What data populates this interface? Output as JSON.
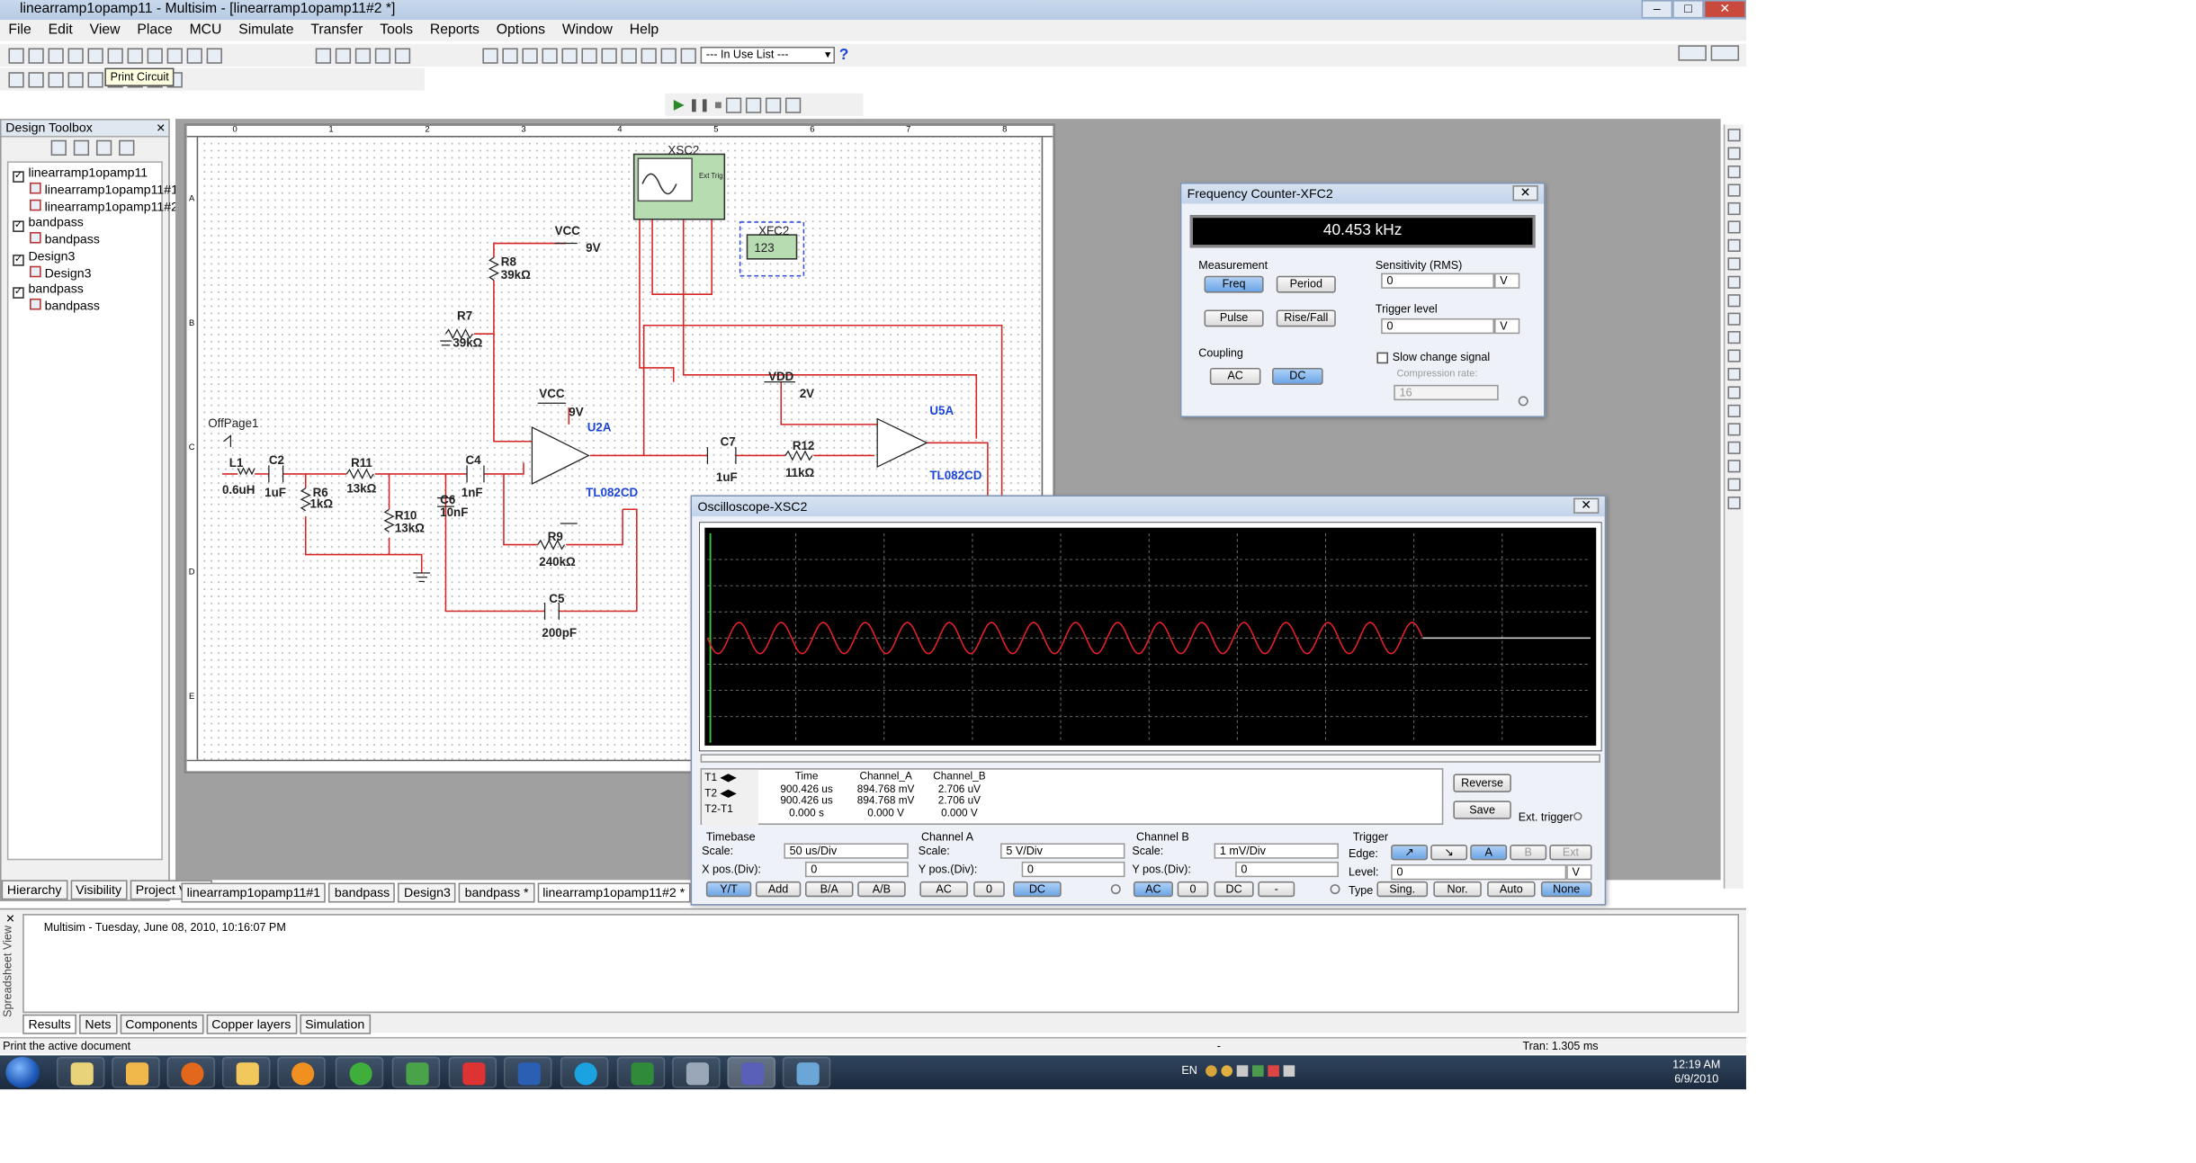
{
  "window": {
    "title": "linearramp1opamp11 - Multisim - [linearramp1opamp11#2 *]",
    "buttons": [
      "–",
      "□",
      "✕"
    ]
  },
  "menu": [
    "File",
    "Edit",
    "View",
    "Place",
    "MCU",
    "Simulate",
    "Transfer",
    "Tools",
    "Reports",
    "Options",
    "Window",
    "Help"
  ],
  "toolbar": {
    "tooltip": "Print Circuit",
    "in_use_list": "--- In Use List ---",
    "help": "?"
  },
  "toolbox": {
    "title": "Design Toolbox",
    "tree": [
      {
        "label": "linearramp1opamp11",
        "level": 0,
        "checked": true
      },
      {
        "label": "linearramp1opamp11#1",
        "level": 1
      },
      {
        "label": "linearramp1opamp11#2",
        "level": 1
      },
      {
        "label": "bandpass",
        "level": 0,
        "checked": true
      },
      {
        "label": "bandpass",
        "level": 1
      },
      {
        "label": "Design3",
        "level": 0,
        "checked": true
      },
      {
        "label": "Design3",
        "level": 1
      },
      {
        "label": "bandpass",
        "level": 0,
        "checked": true
      },
      {
        "label": "bandpass",
        "level": 1
      }
    ],
    "tabs": [
      "Hierarchy",
      "Visibility",
      "Project View"
    ]
  },
  "doc_tabs": [
    "linearramp1opamp11#1",
    "bandpass",
    "Design3",
    "bandpass *",
    "linearramp1opamp11#2 *"
  ],
  "schematic": {
    "ruler_top": [
      "0",
      "1",
      "2",
      "3",
      "4",
      "5",
      "6",
      "7",
      "8"
    ],
    "ruler_left": [
      "A",
      "B",
      "C",
      "D",
      "E"
    ],
    "labels": {
      "xsc2": "XSC2",
      "xfc2": "XFC2",
      "xfc2_val": "123",
      "ext_trig": "Ext Trig",
      "vcc1": "VCC",
      "v9a": "9V",
      "r8": "R8",
      "r8v": "39kΩ",
      "r7": "R7",
      "r7v": "39kΩ",
      "vcc2": "VCC",
      "v9b": "9V",
      "u2a": "U2A",
      "tl1": "TL082CD",
      "offpage": "OffPage1",
      "l1": "L1",
      "l1v": "0.6uH",
      "c2": "C2",
      "c2v": "1uF",
      "r11": "R11",
      "r11v": "13kΩ",
      "c4": "C4",
      "c4v": "1nF",
      "r6": "R6",
      "r6v": "1kΩ",
      "c6": "C6",
      "c6v": "10nF",
      "r10": "R10",
      "r10v": "13kΩ",
      "r9": "R9",
      "r9v": "240kΩ",
      "c5": "C5",
      "c5v": "200pF",
      "vdd": "VDD",
      "v2": "2V",
      "c7": "C7",
      "c7v": "1uF",
      "r12": "R12",
      "r12v": "11kΩ",
      "u5a": "U5A",
      "tl2": "TL082CD"
    }
  },
  "freq_counter": {
    "title": "Frequency Counter-XFC2",
    "display": "40.453 kHz",
    "measurement": "Measurement",
    "freq": "Freq",
    "period": "Period",
    "pulse": "Pulse",
    "risefall": "Rise/Fall",
    "coupling": "Coupling",
    "ac": "AC",
    "dc": "DC",
    "sensitivity": "Sensitivity (RMS)",
    "sens_val": "0",
    "sens_unit": "V",
    "trigger": "Trigger level",
    "trig_val": "0",
    "trig_unit": "V",
    "slow": "Slow change signal",
    "comp": "Compression rate:",
    "comp_val": "16"
  },
  "oscilloscope": {
    "title": "Oscilloscope-XSC2",
    "readout": {
      "headers": [
        "Time",
        "Channel_A",
        "Channel_B"
      ],
      "rows": [
        {
          "label": "T1",
          "time": "900.426 us",
          "a": "894.768 mV",
          "b": "2.706 uV"
        },
        {
          "label": "T2",
          "time": "900.426 us",
          "a": "894.768 mV",
          "b": "2.706 uV"
        },
        {
          "label": "T2-T1",
          "time": "0.000 s",
          "a": "0.000 V",
          "b": "0.000 V"
        }
      ]
    },
    "reverse": "Reverse",
    "save": "Save",
    "ext_trigger": "Ext. trigger",
    "timebase": {
      "title": "Timebase",
      "scale_lbl": "Scale:",
      "scale": "50 us/Div",
      "xpos_lbl": "X pos.(Div):",
      "xpos": "0",
      "buttons": [
        "Y/T",
        "Add",
        "B/A",
        "A/B"
      ]
    },
    "chA": {
      "title": "Channel A",
      "scale_lbl": "Scale:",
      "scale": "5  V/Div",
      "ypos_lbl": "Y pos.(Div):",
      "ypos": "0",
      "buttons": [
        "AC",
        "0",
        "DC"
      ]
    },
    "chB": {
      "title": "Channel B",
      "scale_lbl": "Scale:",
      "scale": "1 mV/Div",
      "ypos_lbl": "Y pos.(Div):",
      "ypos": "0",
      "buttons": [
        "AC",
        "0",
        "DC",
        "-"
      ]
    },
    "trigger": {
      "title": "Trigger",
      "edge_lbl": "Edge:",
      "level_lbl": "Level:",
      "level": "0",
      "level_unit": "V",
      "type_lbl": "Type",
      "edge_btns": [
        "↗",
        "↘",
        "A",
        "B",
        "Ext"
      ],
      "type_btns": [
        "Sing.",
        "Nor.",
        "Auto",
        "None"
      ]
    },
    "trace": {
      "color": "#e8202a",
      "cycles": 17,
      "end_fraction": 0.81
    }
  },
  "spreadsheet": {
    "side": "Spreadsheet View",
    "message": "Multisim  -  Tuesday, June 08, 2010, 10:16:07 PM",
    "tabs": [
      "Results",
      "Nets",
      "Components",
      "Copper layers",
      "Simulation"
    ]
  },
  "status": {
    "left": "Print the active document",
    "mid": "-",
    "right": "Tran: 1.305 ms"
  },
  "taskbar": {
    "lang": "EN",
    "time": "12:19 AM",
    "date": "6/9/2010"
  }
}
